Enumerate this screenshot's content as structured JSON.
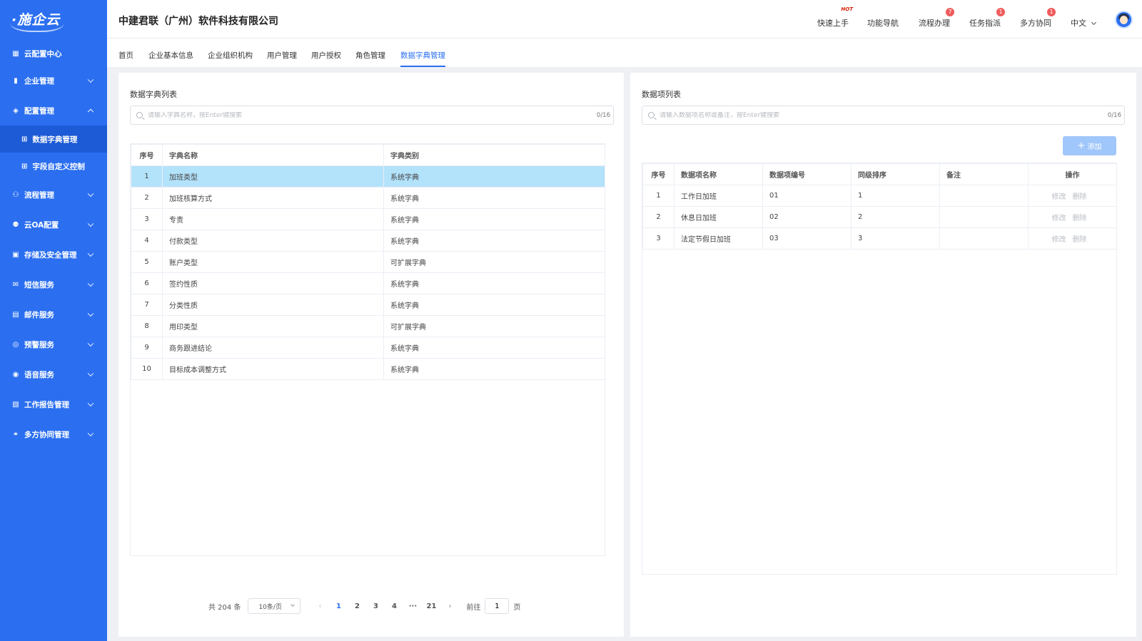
{
  "sidebar": {
    "logo": "·施企云",
    "items": [
      {
        "label": "云配置中心",
        "icon": "grid-icon"
      },
      {
        "label": "企业管理",
        "icon": "building-icon"
      },
      {
        "label": "配置管理",
        "icon": "layers-icon"
      },
      {
        "label": "数据字典管理",
        "icon": "apps-icon"
      },
      {
        "label": "字段自定义控制",
        "icon": "apps-icon"
      },
      {
        "label": "流程管理",
        "icon": "flow-icon"
      },
      {
        "label": "云OA配置",
        "icon": "user-settings-icon"
      },
      {
        "label": "存储及安全管理",
        "icon": "storage-icon"
      },
      {
        "label": "短信服务",
        "icon": "mail-icon"
      },
      {
        "label": "邮件服务",
        "icon": "id-card-icon"
      },
      {
        "label": "预警服务",
        "icon": "alert-icon"
      },
      {
        "label": "语音服务",
        "icon": "voice-icon"
      },
      {
        "label": "工作报告管理",
        "icon": "report-icon"
      },
      {
        "label": "多方协同管理",
        "icon": "collab-icon"
      }
    ]
  },
  "header": {
    "company": "中建君联（广州）软件科技有限公司",
    "links": [
      {
        "label": "快速上手",
        "hot": "HOT"
      },
      {
        "label": "功能导航"
      },
      {
        "label": "流程办理",
        "badge": "7"
      },
      {
        "label": "任务指派",
        "badge": "1"
      },
      {
        "label": "多方协同",
        "badge": "1"
      }
    ],
    "language": "中文"
  },
  "tabs": [
    "首页",
    "企业基本信息",
    "企业组织机构",
    "用户管理",
    "用户授权",
    "角色管理",
    "数据字典管理"
  ],
  "left": {
    "title": "数据字典列表",
    "search_placeholder": "请输入字典名称，按Enter键搜索",
    "search_count": "0/16",
    "columns": [
      "序号",
      "字典名称",
      "字典类别"
    ],
    "rows": [
      [
        "1",
        "加班类型",
        "系统字典"
      ],
      [
        "2",
        "加班核算方式",
        "系统字典"
      ],
      [
        "3",
        "专责",
        "系统字典"
      ],
      [
        "4",
        "付款类型",
        "系统字典"
      ],
      [
        "5",
        "账户类型",
        "可扩展字典"
      ],
      [
        "6",
        "签约性质",
        "系统字典"
      ],
      [
        "7",
        "分类性质",
        "系统字典"
      ],
      [
        "8",
        "用印类型",
        "可扩展字典"
      ],
      [
        "9",
        "商务跟进结论",
        "系统字典"
      ],
      [
        "10",
        "目标成本调整方式",
        "系统字典"
      ]
    ],
    "pagination": {
      "total": "共 204 条",
      "page_size": "10条/页",
      "pages": [
        "1",
        "2",
        "3",
        "4",
        "···",
        "21"
      ],
      "current": "1",
      "goto_prefix": "前往",
      "goto_value": "1",
      "goto_suffix": "页"
    }
  },
  "right": {
    "title": "数据项列表",
    "search_placeholder": "请输入数据项名称或备注，按Enter键搜索",
    "search_count": "0/16",
    "add_label": "添加",
    "columns": [
      "序号",
      "数据项名称",
      "数据项编号",
      "同级排序",
      "备注",
      "操作"
    ],
    "rows": [
      [
        "1",
        "工作日加班",
        "01",
        "1",
        ""
      ],
      [
        "2",
        "休息日加班",
        "02",
        "2",
        ""
      ],
      [
        "3",
        "法定节假日加班",
        "03",
        "3",
        ""
      ]
    ],
    "ops": [
      "修改",
      "删除"
    ]
  },
  "colors": {
    "primary": "#2b6ff0",
    "selected_row": "#b3e2fb",
    "badge": "#f05b5b"
  }
}
